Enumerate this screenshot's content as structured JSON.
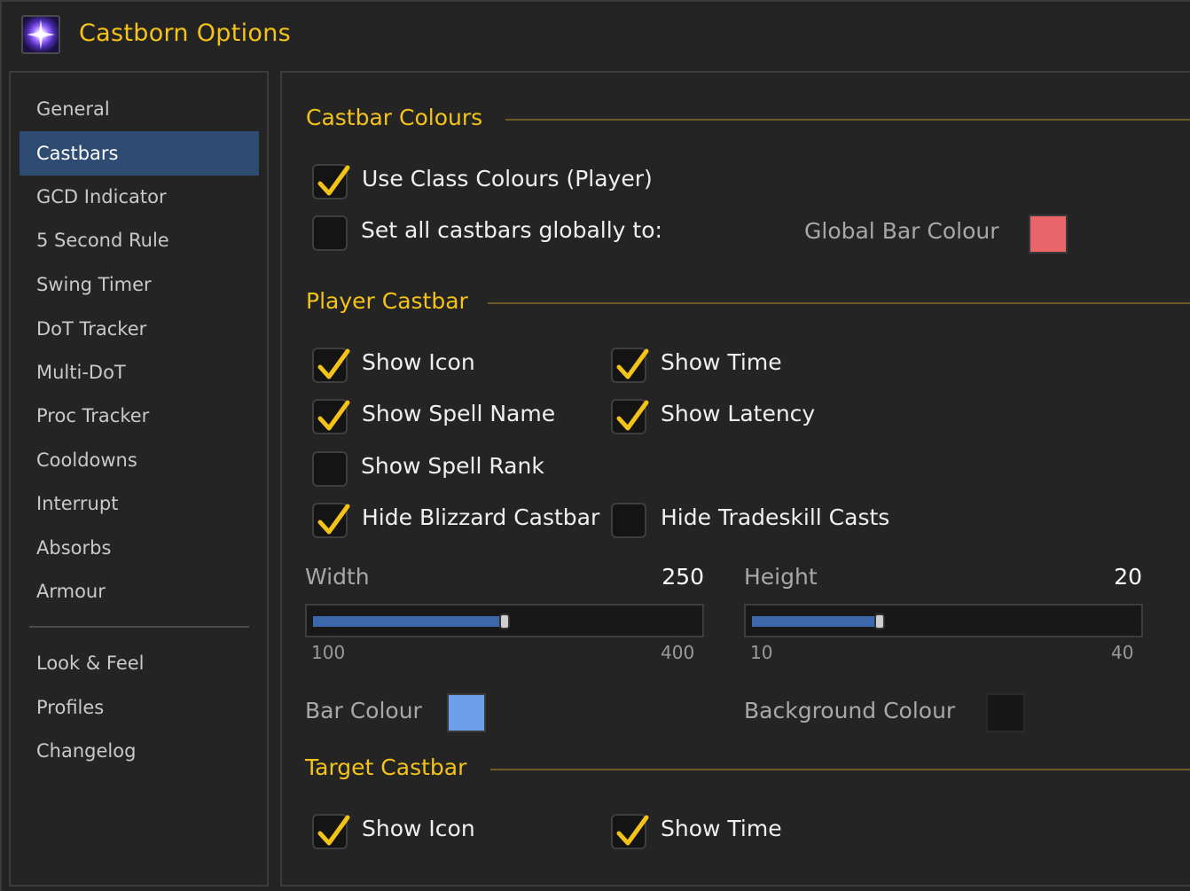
{
  "window": {
    "title": "Castborn Options",
    "icon": "arcane-star-icon"
  },
  "sidebar": {
    "items": [
      {
        "label": "General",
        "active": false
      },
      {
        "label": "Castbars",
        "active": true
      },
      {
        "label": "GCD Indicator",
        "active": false
      },
      {
        "label": "5 Second Rule",
        "active": false
      },
      {
        "label": "Swing Timer",
        "active": false
      },
      {
        "label": "DoT Tracker",
        "active": false
      },
      {
        "label": "Multi-DoT",
        "active": false
      },
      {
        "label": "Proc Tracker",
        "active": false
      },
      {
        "label": "Cooldowns",
        "active": false
      },
      {
        "label": "Interrupt",
        "active": false
      },
      {
        "label": "Absorbs",
        "active": false
      },
      {
        "label": "Armour",
        "active": false
      }
    ],
    "footer_items": [
      {
        "label": "Look & Feel"
      },
      {
        "label": "Profiles"
      },
      {
        "label": "Changelog"
      }
    ]
  },
  "castbar_colours": {
    "heading": "Castbar Colours",
    "use_class_colours": {
      "label": "Use Class Colours (Player)",
      "checked": true
    },
    "set_global": {
      "label": "Set all castbars globally to:",
      "checked": false
    },
    "global_bar_colour": {
      "label": "Global Bar Colour",
      "color": "#e8656a"
    }
  },
  "player_castbar": {
    "heading": "Player Castbar",
    "show_icon": {
      "label": "Show Icon",
      "checked": true
    },
    "show_time": {
      "label": "Show Time",
      "checked": true
    },
    "show_spell_name": {
      "label": "Show Spell Name",
      "checked": true
    },
    "show_latency": {
      "label": "Show Latency",
      "checked": true
    },
    "show_spell_rank": {
      "label": "Show Spell Rank",
      "checked": false
    },
    "hide_blizzard": {
      "label": "Hide Blizzard Castbar",
      "checked": true
    },
    "hide_tradeskill": {
      "label": "Hide Tradeskill Casts",
      "checked": false
    },
    "width": {
      "label": "Width",
      "value": "250",
      "min": "100",
      "max": "400"
    },
    "height": {
      "label": "Height",
      "value": "20",
      "min": "10",
      "max": "40"
    },
    "bar_colour": {
      "label": "Bar Colour",
      "color": "#6ea0ea"
    },
    "background_colour": {
      "label": "Background Colour",
      "color": "#171717"
    }
  },
  "target_castbar": {
    "heading": "Target Castbar",
    "show_icon": {
      "label": "Show Icon",
      "checked": true
    },
    "show_time": {
      "label": "Show Time",
      "checked": true
    }
  },
  "colors": {
    "accent": "#f3c318",
    "selected": "#2e4b72",
    "slider_fill": "#3c67ab"
  }
}
